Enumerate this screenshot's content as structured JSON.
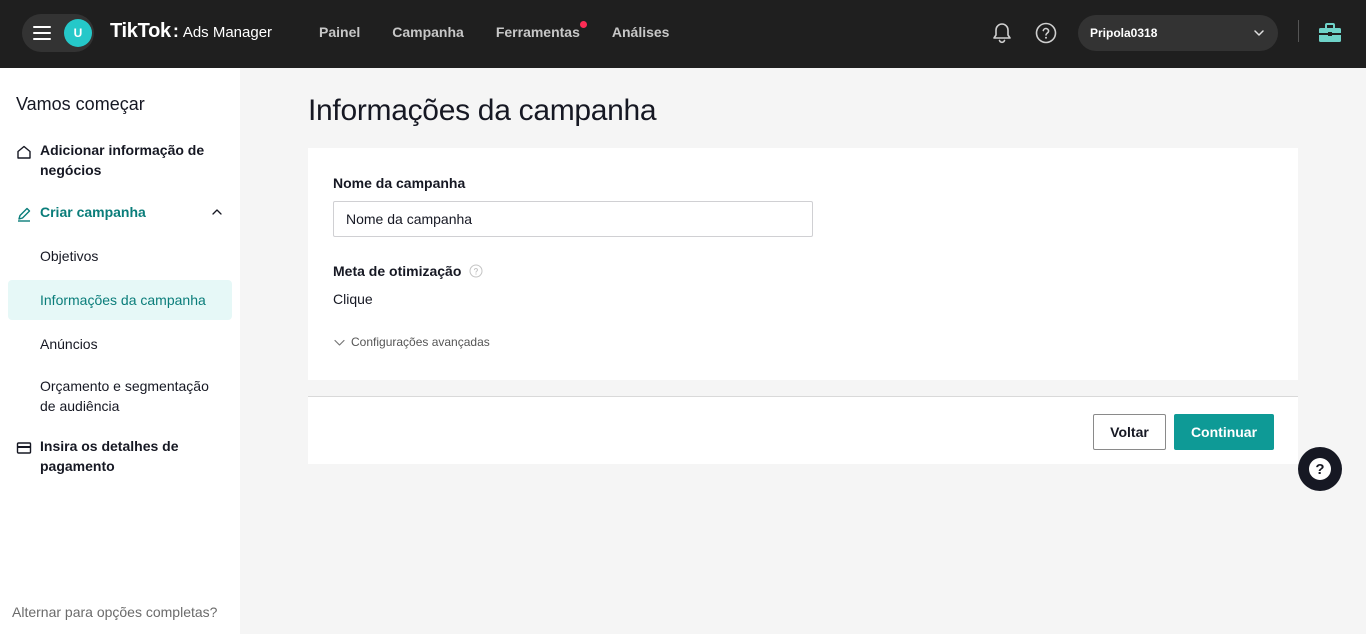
{
  "header": {
    "avatar_initial": "U",
    "brand_name": "TikTok",
    "brand_separator": ":",
    "brand_product": "Ads Manager",
    "nav": [
      {
        "label": "Painel"
      },
      {
        "label": "Campanha"
      },
      {
        "label": "Ferramentas",
        "has_notification_dot": true
      },
      {
        "label": "Análises"
      }
    ],
    "account_name": "Pripola0318",
    "icons": [
      "menu-icon",
      "bell-icon",
      "help-circle-icon",
      "chevron-down-icon",
      "briefcase-icon"
    ]
  },
  "sidebar": {
    "title": "Vamos começar",
    "steps": [
      {
        "label": "Adicionar informação de negócios",
        "icon": "home-icon"
      },
      {
        "label": "Criar campanha",
        "icon": "pencil-icon",
        "expanded": true,
        "substeps": [
          {
            "label": "Objetivos"
          },
          {
            "label": "Informações da campanha",
            "active": true
          },
          {
            "label": "Anúncios"
          },
          {
            "label": "Orçamento e segmentação de audiência"
          }
        ]
      },
      {
        "label": "Insira os detalhes de pagamento",
        "icon": "card-icon"
      }
    ],
    "footer_link": "Alternar para opções completas?"
  },
  "main": {
    "page_title": "Informações da campanha",
    "campaign_name_label": "Nome da campanha",
    "campaign_name_value": "Nome da campanha",
    "optimization_label": "Meta de otimização",
    "optimization_value": "Clique",
    "advanced_settings": "Configurações avançadas",
    "back_button": "Voltar",
    "continue_button": "Continuar"
  },
  "colors": {
    "topbar": "#1f1f1f",
    "accent_teal": "#0e9a96",
    "active_text": "#0a7d7a",
    "active_bg": "#e6f8f7",
    "notification_red": "#fe2c55"
  }
}
